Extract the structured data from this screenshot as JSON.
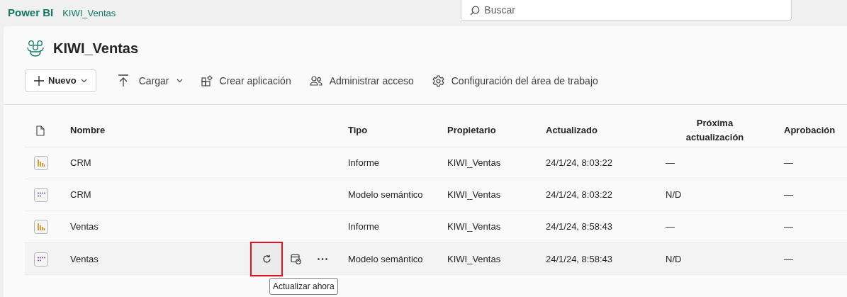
{
  "header": {
    "product": "Power BI",
    "workspace": "KIWI_Ventas",
    "search": {
      "placeholder": "Buscar"
    }
  },
  "workspace": {
    "title": "KIWI_Ventas"
  },
  "toolbar": [
    {
      "kind": "primary",
      "label": "Nuevo",
      "caret": true
    },
    {
      "kind": "upload",
      "label": "Cargar",
      "caret": true
    },
    {
      "kind": "app",
      "label": "Crear aplicación",
      "caret": false
    },
    {
      "kind": "access",
      "label": "Administrar acceso",
      "caret": false
    },
    {
      "kind": "settings",
      "label": "Configuración del área de trabajo",
      "caret": false
    }
  ],
  "table": {
    "columns": [
      "Nombre",
      "Tipo",
      "Propietario",
      "Actualizado",
      "Próxima actualización",
      "Aprobación"
    ],
    "rows": [
      {
        "kind": "report",
        "name": "CRM",
        "type": "Informe",
        "owner": "KIWI_Ventas",
        "updated": "24/1/24, 8:03:22",
        "next": "—",
        "approval": "—",
        "hovered": false
      },
      {
        "kind": "model",
        "name": "CRM",
        "type": "Modelo semántico",
        "owner": "KIWI_Ventas",
        "updated": "24/1/24, 8:03:22",
        "next": "N/D",
        "approval": "—",
        "hovered": false
      },
      {
        "kind": "report",
        "name": "Ventas",
        "type": "Informe",
        "owner": "KIWI_Ventas",
        "updated": "24/1/24, 8:58:43",
        "next": "—",
        "approval": "—",
        "hovered": false
      },
      {
        "kind": "model",
        "name": "Ventas",
        "type": "Modelo semántico",
        "owner": "KIWI_Ventas",
        "updated": "24/1/24, 8:58:43",
        "next": "N/D",
        "approval": "—",
        "hovered": true,
        "tooltip": "Actualizar ahora",
        "refresh_outlined": true
      }
    ]
  }
}
